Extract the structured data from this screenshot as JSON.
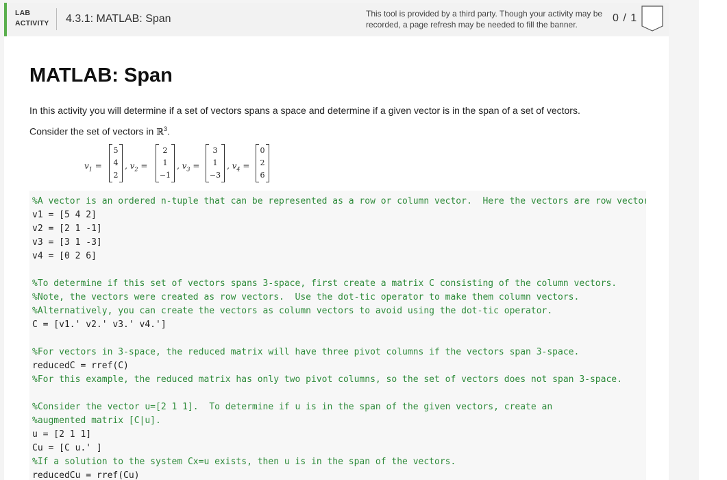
{
  "banner": {
    "lab_label_line1": "LAB",
    "lab_label_line2": "ACTIVITY",
    "activity_title": "4.3.1: MATLAB: Span",
    "note": "This tool is provided by a third party. Though your activity may be recorded, a page refresh may be needed to fill the banner.",
    "score": "0 / 1"
  },
  "page": {
    "title": "MATLAB: Span",
    "intro": "In this activity you will determine if a set of vectors spans a space and determine if a given vector is in the span of a set of vectors.",
    "consider_prefix": "Consider the set of vectors in ",
    "space_symbol": "ℝ",
    "space_exponent": "3",
    "consider_suffix": "."
  },
  "vectors": [
    {
      "label": "v",
      "index": "1",
      "entries": [
        "5",
        "4",
        "2"
      ]
    },
    {
      "label": "v",
      "index": "2",
      "entries": [
        "2",
        "1",
        "−1"
      ]
    },
    {
      "label": "v",
      "index": "3",
      "entries": [
        "3",
        "1",
        "−3"
      ]
    },
    {
      "label": "v",
      "index": "4",
      "entries": [
        "0",
        "2",
        "6"
      ]
    }
  ],
  "code": {
    "lines": [
      {
        "type": "comment",
        "text": "%A vector is an ordered n-tuple that can be represented as a row or column vector.  Here the vectors are row vectors."
      },
      {
        "type": "code",
        "text": "v1 = [5 4 2]"
      },
      {
        "type": "code",
        "text": "v2 = [2 1 -1]"
      },
      {
        "type": "code",
        "text": "v3 = [3 1 -3]"
      },
      {
        "type": "code",
        "text": "v4 = [0 2 6]"
      },
      {
        "type": "blank",
        "text": ""
      },
      {
        "type": "comment",
        "text": "%To determine if this set of vectors spans 3-space, first create a matrix C consisting of the column vectors."
      },
      {
        "type": "comment",
        "text": "%Note, the vectors were created as row vectors.  Use the dot-tic operator to make them column vectors."
      },
      {
        "type": "comment",
        "text": "%Alternatively, you can create the vectors as column vectors to avoid using the dot-tic operator."
      },
      {
        "type": "code",
        "text": "C = [v1.' v2.' v3.' v4.']"
      },
      {
        "type": "blank",
        "text": ""
      },
      {
        "type": "comment",
        "text": "%For vectors in 3-space, the reduced matrix will have three pivot columns if the vectors span 3-space."
      },
      {
        "type": "code",
        "text": "reducedC = rref(C)"
      },
      {
        "type": "comment",
        "text": "%For this example, the reduced matrix has only two pivot columns, so the set of vectors does not span 3-space."
      },
      {
        "type": "blank",
        "text": ""
      },
      {
        "type": "comment",
        "text": "%Consider the vector u=[2 1 1].  To determine if u is in the span of the given vectors, create an"
      },
      {
        "type": "comment",
        "text": "%augmented matrix [C|u]."
      },
      {
        "type": "code",
        "text": "u = [2 1 1]"
      },
      {
        "type": "code",
        "text": "Cu = [C u.' ]"
      },
      {
        "type": "comment",
        "text": "%If a solution to the system Cx=u exists, then u is in the span of the vectors."
      },
      {
        "type": "code",
        "text": "reducedCu = rref(Cu)"
      }
    ]
  },
  "colors": {
    "accent_green": "#5aae4d",
    "comment_green": "#2e8b3a"
  },
  "icons": {
    "bookmark": "bookmark-icon"
  }
}
